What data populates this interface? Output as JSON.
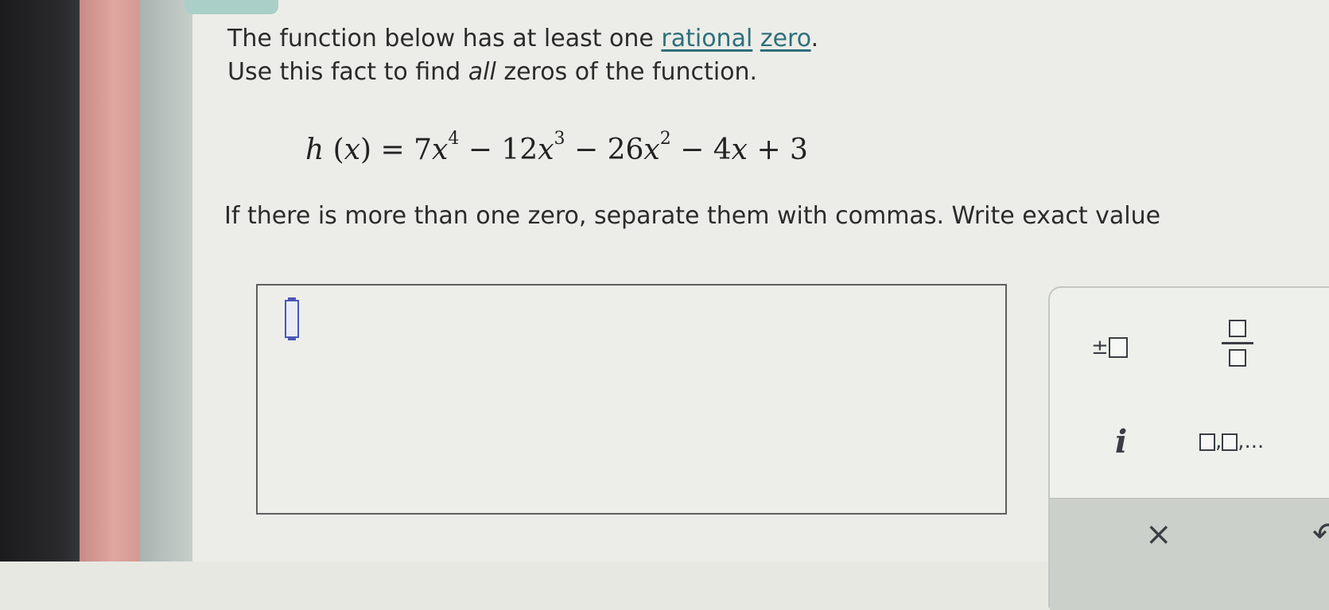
{
  "problem": {
    "line1_prefix": "The function below has at least one ",
    "link1": "rational",
    "link2": "zero",
    "line1_suffix": ".",
    "line2_prefix": "Use this fact to find ",
    "line2_emph": "all",
    "line2_suffix": " zeros of the function."
  },
  "equation": {
    "fname": "h",
    "var": "x",
    "c1": "7",
    "e1": "4",
    "c2": "12",
    "e2": "3",
    "c3": "26",
    "e3": "2",
    "c4": "4",
    "c5": "3"
  },
  "note": "If there is more than one zero, separate them with commas. Write exact value",
  "answer": {
    "value": ""
  },
  "keypad": {
    "plus_minus": "±",
    "imaginary": "i",
    "list_sep": ",",
    "list_ellipsis": ",...",
    "clear": "×",
    "undo": "↶"
  },
  "colors": {
    "link": "#2e6f7b",
    "cursor": "#4a57b8",
    "keypad_bottom": "#cbd0ca"
  }
}
